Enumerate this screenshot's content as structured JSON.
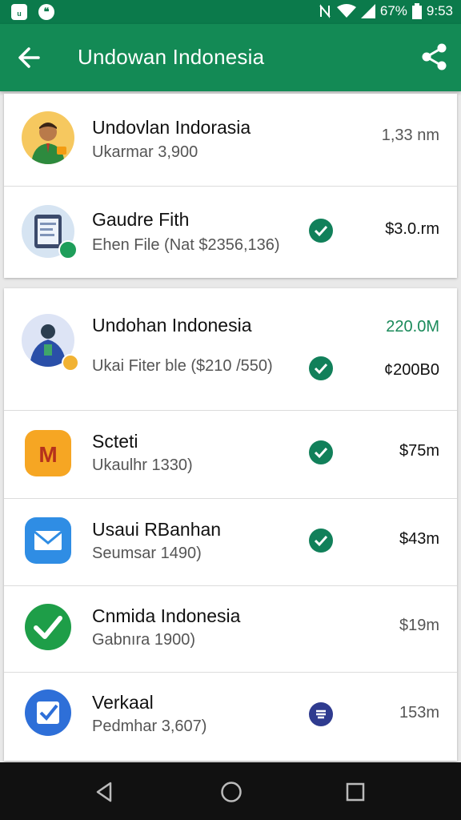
{
  "status_bar": {
    "battery": "67%",
    "time": "9:53"
  },
  "header": {
    "title": "Undowan Indonesia"
  },
  "list1": [
    {
      "name": "Undovlan Indorasia",
      "subtitle": "Ukarmar 3,900",
      "amount": "1,33 nm"
    },
    {
      "name": "Gaudre Fith",
      "subtitle": "Ehen File (Nat $2356,136)",
      "amount": "$3.0.rm"
    }
  ],
  "list2": [
    {
      "name": "Undohan Indonesia",
      "subtitle": "Ukai Fiter ble ($210 /550)",
      "amount_top": "220.0M",
      "amount": "¢200B0"
    },
    {
      "name": "Scteti",
      "subtitle": "Ukaulhr 1330)",
      "amount": "$75m"
    },
    {
      "name": "Usaui RBanhan",
      "subtitle": "Seumsar 1490)",
      "amount": "$43m"
    },
    {
      "name": "Cnmida Indonesia",
      "subtitle": "Gabnıra 1900)",
      "amount": "$19m"
    },
    {
      "name": "Verkaal",
      "subtitle": "Pedmhar 3,607)",
      "amount": "153m"
    }
  ],
  "colors": {
    "primary": "#138a55",
    "status_bar": "#0b7a4b",
    "check": "#11805a"
  },
  "icons": [
    "back-arrow-icon",
    "share-icon",
    "check-circle-icon",
    "email-icon",
    "doc-icon"
  ]
}
